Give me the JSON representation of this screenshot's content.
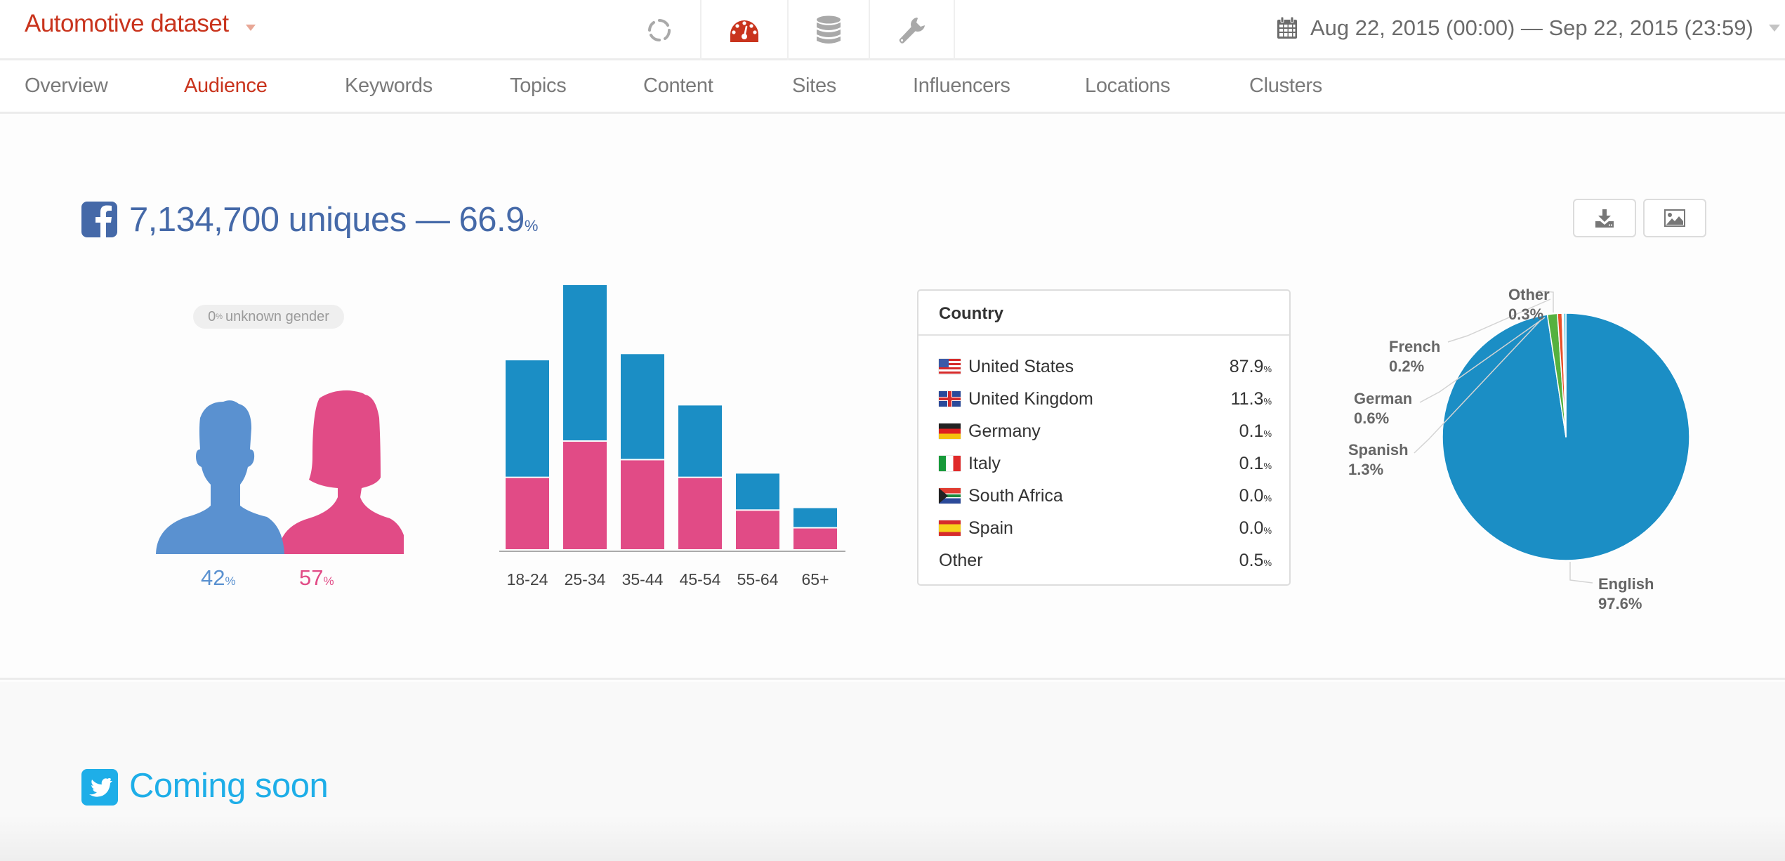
{
  "header": {
    "dataset_title": "Automotive dataset",
    "icons": [
      {
        "name": "refresh-icon",
        "active": false
      },
      {
        "name": "dashboard-icon",
        "active": true
      },
      {
        "name": "database-icon",
        "active": false
      },
      {
        "name": "wrench-icon",
        "active": false
      }
    ],
    "date_range": "Aug 22, 2015 (00:00) — Sep 22, 2015 (23:59)"
  },
  "nav": {
    "tabs": [
      {
        "label": "Overview",
        "active": false
      },
      {
        "label": "Audience",
        "active": true
      },
      {
        "label": "Keywords",
        "active": false
      },
      {
        "label": "Topics",
        "active": false
      },
      {
        "label": "Content",
        "active": false
      },
      {
        "label": "Sites",
        "active": false
      },
      {
        "label": "Influencers",
        "active": false
      },
      {
        "label": "Locations",
        "active": false
      },
      {
        "label": "Clusters",
        "active": false
      }
    ]
  },
  "facebook": {
    "uniques": "7,134,700 uniques — 66.9",
    "pct_sign": "%",
    "toolbar": {
      "download_icon": "download-icon",
      "image_icon": "image-icon"
    },
    "gender": {
      "unknown_value": "0",
      "unknown_pct_sign": "%",
      "unknown_label": "unknown gender",
      "male_value": "42",
      "female_value": "57",
      "pct_sign": "%",
      "male_color": "#5a91d0",
      "female_color": "#e14b86"
    },
    "country": {
      "header": "Country",
      "rows": [
        {
          "name": "United States",
          "value": "87.9",
          "flag": "us"
        },
        {
          "name": "United Kingdom",
          "value": "11.3",
          "flag": "gb"
        },
        {
          "name": "Germany",
          "value": "0.1",
          "flag": "de"
        },
        {
          "name": "Italy",
          "value": "0.1",
          "flag": "it"
        },
        {
          "name": "South Africa",
          "value": "0.0",
          "flag": "za"
        },
        {
          "name": "Spain",
          "value": "0.0",
          "flag": "es"
        },
        {
          "name": "Other",
          "value": "0.5",
          "flag": null
        }
      ],
      "pct_sign": "%"
    }
  },
  "twitter": {
    "heading": "Coming soon"
  },
  "chart_data": [
    {
      "type": "bar",
      "stacked": true,
      "title": "",
      "xlabel": "",
      "ylabel": "",
      "categories": [
        "18-24",
        "25-34",
        "35-44",
        "45-54",
        "55-64",
        "65+"
      ],
      "series": [
        {
          "name": "female",
          "color": "#e14b86",
          "values": [
            8.2,
            12.3,
            10.2,
            8.2,
            4.5,
            2.5
          ]
        },
        {
          "name": "male",
          "color": "#1b8ec5",
          "values": [
            13.3,
            17.7,
            12.0,
            8.2,
            4.2,
            2.3
          ]
        }
      ],
      "ylim": [
        0,
        30
      ],
      "grid": false
    },
    {
      "type": "pie",
      "title": "",
      "slices": [
        {
          "label": "English",
          "value": 97.6,
          "display": "97.6%",
          "color": "#1b8ec5"
        },
        {
          "label": "Spanish",
          "value": 1.3,
          "display": "1.3%",
          "color": "#55b13f"
        },
        {
          "label": "German",
          "value": 0.6,
          "display": "0.6%",
          "color": "#e8502a"
        },
        {
          "label": "French",
          "value": 0.2,
          "display": "0.2%",
          "color": "#f4f4f4"
        },
        {
          "label": "Other",
          "value": 0.3,
          "display": "0.3%",
          "color": "#4fc6e0"
        }
      ]
    }
  ]
}
